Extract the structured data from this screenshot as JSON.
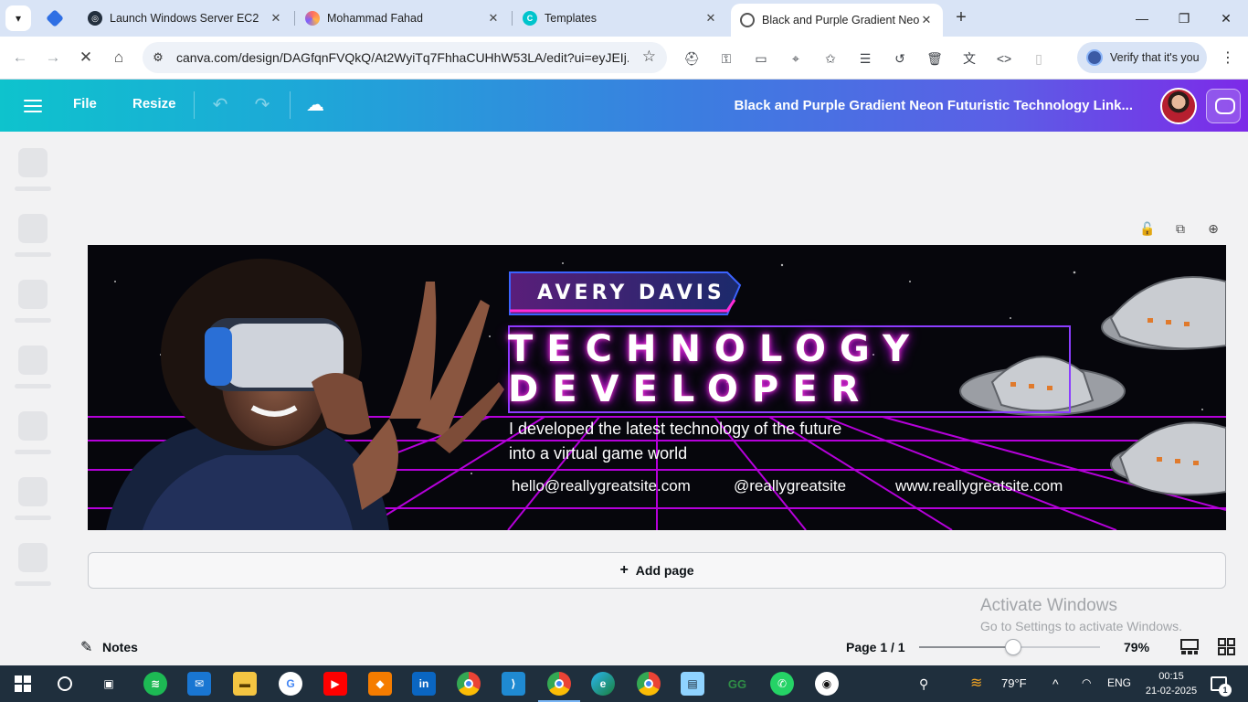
{
  "browser": {
    "tabs": [
      {
        "title": "Launch Windows Server EC2",
        "icon": "ec2-favicon",
        "color": "#232f3e"
      },
      {
        "title": "Mohammad Fahad",
        "icon": "profile-favicon",
        "color": "#ff6f61"
      },
      {
        "title": "Templates",
        "icon": "canva-favicon",
        "color": "#00c4cc"
      },
      {
        "title": "Black and Purple Gradient Neon",
        "icon": "canva-favicon",
        "color": "#00c4cc"
      }
    ],
    "url": "canva.com/design/DAGfqnFVQkQ/At2WyiTq7FhhaCUHhW53LA/edit?ui=eyJEIj...",
    "verify_label": "Verify that it's you"
  },
  "canva": {
    "file_label": "File",
    "resize_label": "Resize",
    "design_title": "Black and Purple Gradient Neon Futuristic Technology Link...",
    "add_page_label": "Add page",
    "notes_label": "Notes",
    "page_indicator": "Page 1 / 1",
    "zoom_label": "79%",
    "zoom_fraction": 0.52
  },
  "design": {
    "name": "AVERY DAVIS",
    "title_line1": "TECHNOLOGY",
    "title_line2": "DEVELOPER",
    "desc_line1": "I developed the latest technology of the future",
    "desc_line2": "into a virtual game world",
    "email": "hello@reallygreatsite.com",
    "handle": "@reallygreatsite",
    "website": "www.reallygreatsite.com"
  },
  "watermark": {
    "line1": "Activate Windows",
    "line2": "Go to Settings to activate Windows."
  },
  "taskbar": {
    "apps": [
      "start",
      "search",
      "task-view",
      "spotify",
      "mail",
      "file-explorer",
      "google",
      "youtube",
      "package",
      "linkedin",
      "chrome",
      "vscode",
      "chrome-profile",
      "edge",
      "chrome-alt",
      "notepad",
      "geeksforgeeks",
      "whatsapp",
      "github"
    ],
    "weather": "79°F",
    "lang": "ENG",
    "time": "00:15",
    "date": "21-02-2025",
    "notifications": "1"
  },
  "colors": {
    "canva_purple": "#8b3dff",
    "neon_pink": "#ff3fd8"
  }
}
